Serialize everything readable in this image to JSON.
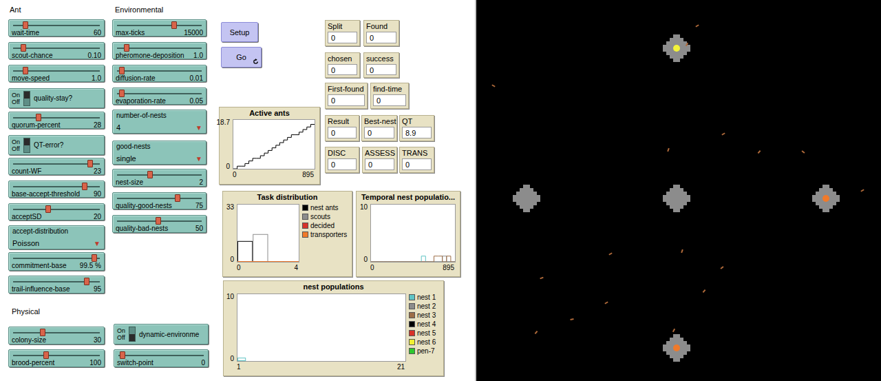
{
  "sections": [
    {
      "label": "Ant"
    },
    {
      "label": "Environmental"
    },
    {
      "label": "Physical"
    }
  ],
  "widgets": [
    {
      "kind": "slider",
      "label": "wait-time",
      "value": "60",
      "level": 0.13
    },
    {
      "kind": "slider",
      "label": "scout-chance",
      "value": "0.10",
      "level": 0.11
    },
    {
      "kind": "slider",
      "label": "move-speed",
      "value": "1.0",
      "level": 0.13
    },
    {
      "kind": "switch",
      "label": "quality-stay?",
      "on": true,
      "on_label": "On",
      "off_label": "Off"
    },
    {
      "kind": "slider",
      "label": "quorum-percent",
      "value": "28",
      "level": 0.29
    },
    {
      "kind": "switch",
      "label": "QT-error?",
      "on": true,
      "on_label": "On",
      "off_label": "Off"
    },
    {
      "kind": "slider",
      "label": "count-WF",
      "value": "23",
      "level": 0.9
    },
    {
      "kind": "slider",
      "label": "base-accept-threshold",
      "value": "90",
      "level": 0.84
    },
    {
      "kind": "slider",
      "label": "acceptSD",
      "value": "20",
      "level": 0.4
    },
    {
      "kind": "chooser",
      "label": "accept-distribution",
      "value": "Poisson",
      "arrow": "▼"
    },
    {
      "kind": "slider",
      "label": "commitment-base",
      "value": "99.5 %",
      "level": 0.95
    },
    {
      "kind": "slider",
      "label": "trail-influence-base",
      "value": "95",
      "level": 0.86
    },
    {
      "kind": "slider",
      "label": "max-ticks",
      "value": "15000",
      "level": 0.68
    },
    {
      "kind": "slider",
      "label": "pheromone-deposition",
      "value": "1.0",
      "level": 0.1
    },
    {
      "kind": "slider",
      "label": "diffusion-rate",
      "value": "0.01",
      "level": 0.04
    },
    {
      "kind": "slider",
      "label": "evaporation-rate",
      "value": "0.05",
      "level": 0.04
    },
    {
      "kind": "chooser",
      "label": "number-of-nests",
      "value": "4",
      "arrow": "▼"
    },
    {
      "kind": "chooser",
      "label": "good-nests",
      "value": "single",
      "arrow": "▼"
    },
    {
      "kind": "slider",
      "label": "nest-size",
      "value": "2",
      "level": 0.39
    },
    {
      "kind": "slider",
      "label": "quality-good-nests",
      "value": "75",
      "level": 0.72
    },
    {
      "kind": "slider",
      "label": "quality-bad-nests",
      "value": "50",
      "level": 0.49
    },
    {
      "kind": "slider",
      "label": "colony-size",
      "value": "30",
      "level": 0.34
    },
    {
      "kind": "slider",
      "label": "brood-percent",
      "value": "100",
      "level": 0.38
    },
    {
      "kind": "switch",
      "label": "dynamic-environme",
      "on": false,
      "on_label": "On",
      "off_label": "Off"
    },
    {
      "kind": "slider",
      "label": "switch-point",
      "value": "0",
      "level": 0.03
    }
  ],
  "buttons": [
    {
      "label": "Setup",
      "forever": false
    },
    {
      "label": "Go",
      "forever": true
    }
  ],
  "monitors": [
    {
      "label": "Split",
      "value": "0"
    },
    {
      "label": "Found",
      "value": "0"
    },
    {
      "label": "chosen",
      "value": "0"
    },
    {
      "label": "success",
      "value": "0"
    },
    {
      "label": "First-found",
      "value": "0"
    },
    {
      "label": "find-time",
      "value": "0"
    },
    {
      "label": "Result",
      "value": "0"
    },
    {
      "label": "Best-nest",
      "value": "0"
    },
    {
      "label": "QT",
      "value": "8.9"
    },
    {
      "label": "DISC",
      "value": "0"
    },
    {
      "label": "ASSESS",
      "value": "0"
    },
    {
      "label": "TRANS",
      "value": "0"
    }
  ],
  "plots": [
    {
      "title": "Active ants",
      "kind": "line",
      "y_max": "18.7",
      "y_min": "0",
      "x_min": "0",
      "x_max": "895",
      "series": [
        {
          "color": "#000000",
          "values": [
            0,
            0,
            1,
            1,
            2,
            3,
            4,
            4,
            5,
            6,
            7,
            8,
            9,
            10,
            11,
            12,
            13,
            13,
            14,
            15,
            16,
            17
          ]
        }
      ]
    },
    {
      "title": "Task distribution",
      "kind": "histogram",
      "y_max": "33",
      "y_min": "0",
      "x_min": "0",
      "x_max": "4",
      "series": [
        {
          "name": "nest ants",
          "color": "#000000",
          "values": [
            12,
            0,
            0,
            0
          ]
        },
        {
          "name": "scouts",
          "color": "#8c8c8c",
          "values": [
            0,
            16,
            0,
            0
          ]
        },
        {
          "name": "decided",
          "color": "#d73229",
          "values": [
            0,
            0,
            0.2,
            0
          ]
        },
        {
          "name": "transporters",
          "color": "#f07a2a",
          "values": [
            0,
            0,
            0,
            0.2
          ]
        }
      ]
    },
    {
      "title": "Temporal nest populatio...",
      "kind": "line",
      "y_max": "10",
      "y_min": "0",
      "x_min": "0",
      "x_max": "895",
      "series": [
        {
          "color": "#d73229",
          "values": [
            0,
            0,
            0,
            0,
            0,
            0,
            0,
            0,
            0,
            0,
            0,
            0,
            0,
            0,
            0,
            0,
            0,
            0,
            0,
            0,
            0
          ]
        },
        {
          "color": "#5fc4c4",
          "values": [
            0,
            0,
            0,
            0,
            0,
            0,
            0,
            0,
            0,
            0,
            0,
            0,
            0,
            1,
            0,
            0,
            0,
            0,
            0,
            0,
            0
          ]
        },
        {
          "color": "#8c8c8c",
          "values": [
            0,
            0,
            0,
            0,
            0,
            0,
            0,
            0,
            0,
            0,
            0,
            0,
            0,
            0,
            0,
            0,
            0,
            0,
            1,
            0,
            0
          ]
        },
        {
          "color": "#9d6e48",
          "values": [
            0,
            0,
            0,
            0,
            0,
            0,
            0,
            0,
            0,
            0,
            0,
            0,
            0,
            0,
            0,
            0,
            1,
            1,
            0,
            1,
            0
          ]
        }
      ]
    },
    {
      "title": "nest populations",
      "kind": "histogram",
      "y_max": "10",
      "y_min": "0",
      "x_min": "1",
      "x_max": "21",
      "series": [
        {
          "name": "nest 1",
          "color": "#5fc4c4",
          "values": [
            0.5
          ]
        },
        {
          "name": "nest 2",
          "color": "#8c8c8c",
          "values": []
        },
        {
          "name": "nest 3",
          "color": "#9d6e48",
          "values": []
        },
        {
          "name": "nest 4",
          "color": "#000000",
          "values": []
        },
        {
          "name": "nest 5",
          "color": "#d73229",
          "values": []
        },
        {
          "name": "nest 6",
          "color": "#f0f032",
          "values": []
        },
        {
          "name": "pen-7",
          "color": "#2ec82e",
          "values": []
        }
      ]
    }
  ],
  "world": {
    "nests": [
      {
        "marker": true,
        "color": "#f2f23a"
      },
      {
        "marker": false,
        "color": "#8c8c8c"
      },
      {
        "marker": false,
        "color": "#8c8c8c"
      },
      {
        "marker": true,
        "color": "#f07a2a"
      },
      {
        "marker": true,
        "color": "#f07a2a"
      }
    ]
  }
}
